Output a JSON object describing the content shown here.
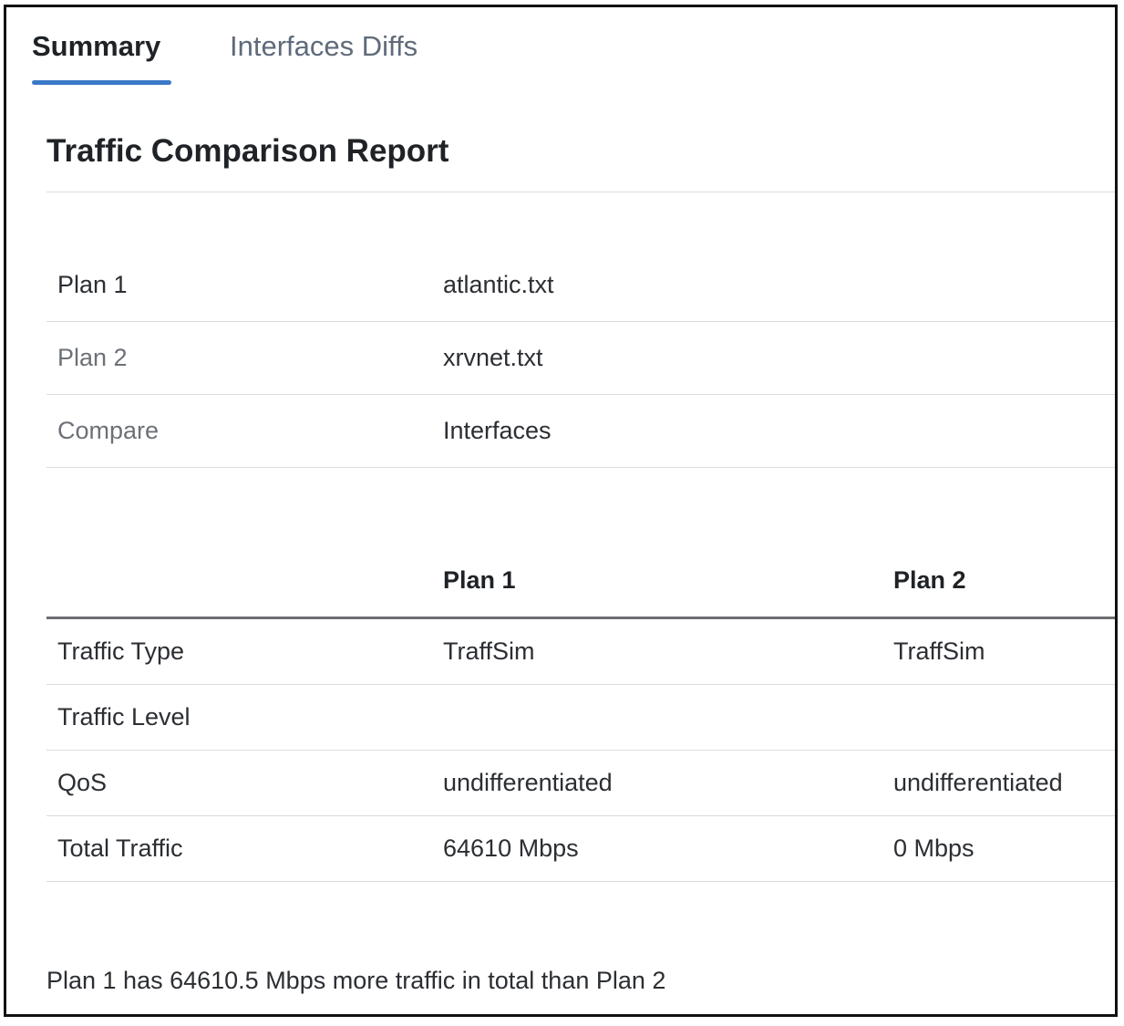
{
  "tabs": [
    {
      "label": "Summary",
      "active": true
    },
    {
      "label": "Interfaces Diffs",
      "active": false
    }
  ],
  "report": {
    "title": "Traffic Comparison Report",
    "info_rows": [
      {
        "label": "Plan 1",
        "value": "atlantic.txt"
      },
      {
        "label": "Plan 2",
        "value": "xrvnet.txt"
      },
      {
        "label": "Compare",
        "value": "Interfaces"
      }
    ],
    "table": {
      "headers": [
        "",
        "Plan 1",
        "Plan 2"
      ],
      "rows": [
        {
          "label": "Traffic Type",
          "plan1": "TraffSim",
          "plan2": "TraffSim"
        },
        {
          "label": "Traffic Level",
          "plan1": "",
          "plan2": ""
        },
        {
          "label": "QoS",
          "plan1": "undifferentiated",
          "plan2": "undifferentiated"
        },
        {
          "label": "Total Traffic",
          "plan1": "64610 Mbps",
          "plan2": "0 Mbps"
        }
      ]
    },
    "summary_note": "Plan 1 has 64610.5 Mbps more traffic in total than Plan 2"
  },
  "colors": {
    "accent": "#3a78c8",
    "text": "#2b2e33",
    "muted_text": "#6c7178",
    "divider": "#dcdcdc",
    "header_rule": "#6d6f72"
  }
}
